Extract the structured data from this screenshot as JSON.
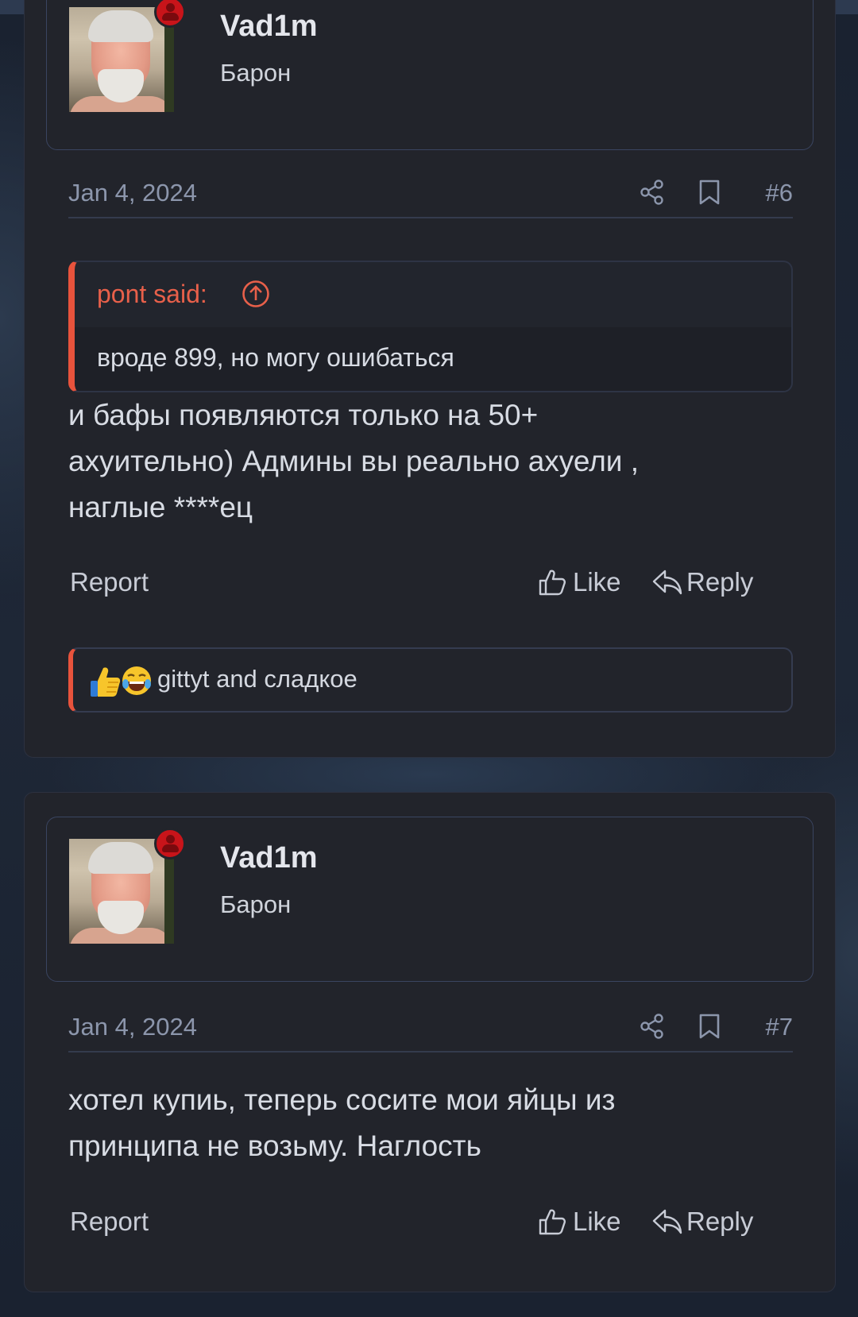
{
  "posts": [
    {
      "user": {
        "name": "Vad1m",
        "title": "Барон"
      },
      "date": "Jan 4, 2024",
      "number": "#6",
      "quote": {
        "author": "pont said:",
        "text": "вроде 899, но могу ошибаться"
      },
      "text": [
        "и бафы появляются только на 50+",
        "ахуительно) Админы вы реально ахуели ,",
        "наглые ****ец"
      ],
      "actions": {
        "report": "Report",
        "like": "Like",
        "reply": "Reply"
      },
      "reactions": {
        "text": "gittyt and сладкое",
        "icons": [
          "thumbs-up-emoji",
          "laughing-emoji"
        ]
      }
    },
    {
      "user": {
        "name": "Vad1m",
        "title": "Барон"
      },
      "date": "Jan 4, 2024",
      "number": "#7",
      "text": [
        "хотел купиь, теперь сосите мои яйцы из",
        "принципа не возьму. Наглость"
      ],
      "actions": {
        "report": "Report",
        "like": "Like",
        "reply": "Reply"
      }
    }
  ],
  "colors": {
    "accent": "#e8533c",
    "online": "#c8141a",
    "meta": "#8c96ac",
    "panel": "#22242b"
  }
}
